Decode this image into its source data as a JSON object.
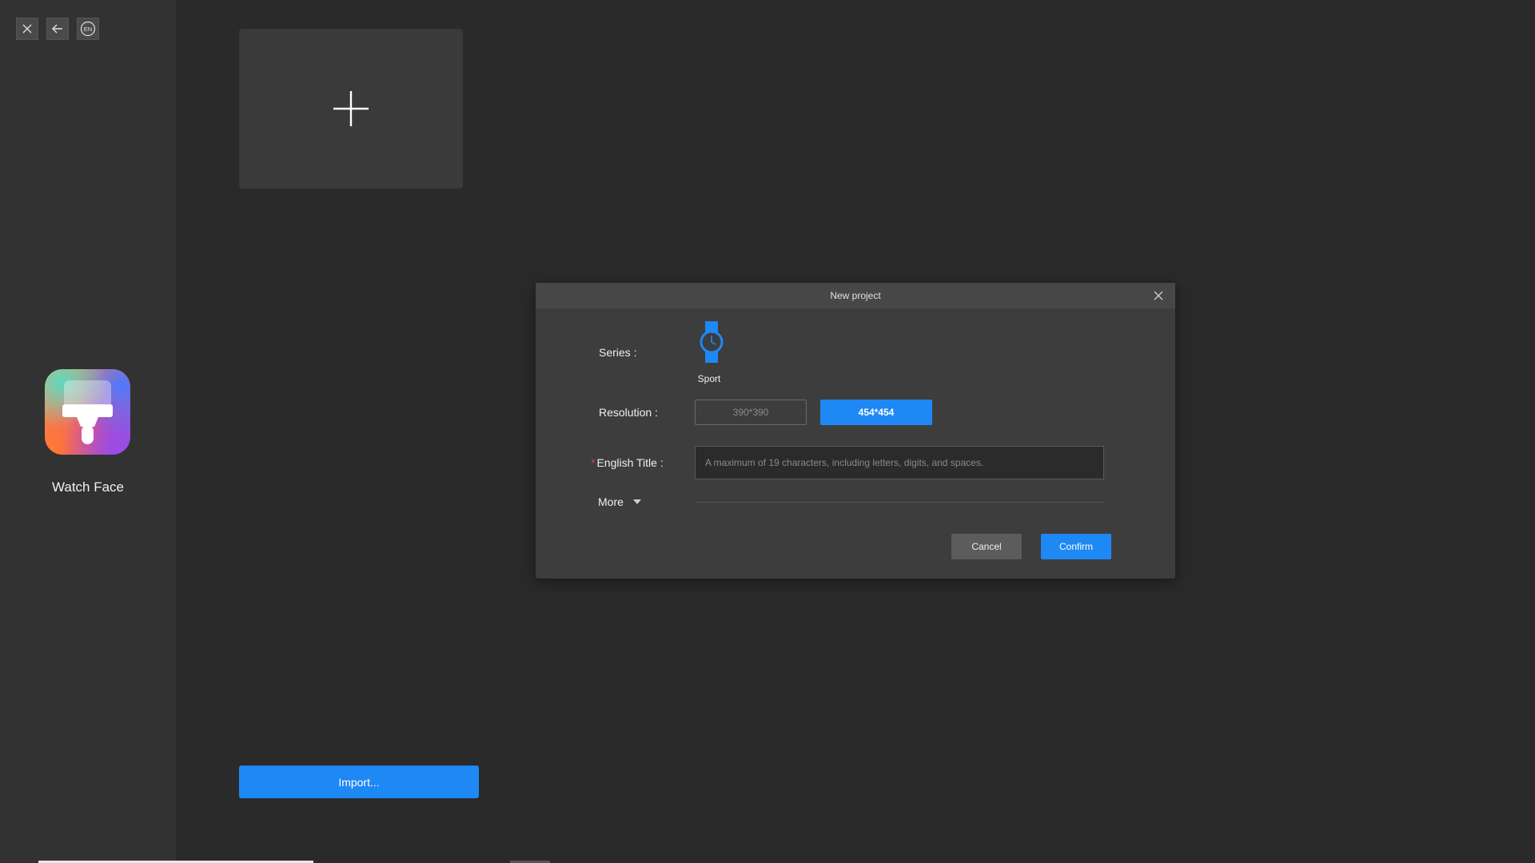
{
  "sidebar": {
    "app_name": "Watch Face",
    "buttons": [
      {
        "icon": "close-icon"
      },
      {
        "icon": "back-arrow-icon"
      },
      {
        "icon": "language-icon",
        "text": "EN"
      }
    ]
  },
  "main": {
    "new_card_icon": "plus-icon",
    "import_label": "Import..."
  },
  "dialog": {
    "title": "New project",
    "series": {
      "label": "Series :",
      "options": [
        {
          "name": "Sport",
          "icon": "watch-icon",
          "selected": true
        }
      ]
    },
    "resolution": {
      "label": "Resolution :",
      "options": [
        {
          "value": "390*390",
          "selected": false
        },
        {
          "value": "454*454",
          "selected": true
        }
      ]
    },
    "english_title": {
      "required_mark": "*",
      "label": "English Title :",
      "value": "",
      "placeholder": "A maximum of 19 characters, including letters, digits, and spaces."
    },
    "more_label": "More",
    "cancel_label": "Cancel",
    "confirm_label": "Confirm"
  },
  "colors": {
    "accent": "#1e88f5",
    "background": "#2a2a2a",
    "sidebar": "#323232",
    "dialog": "#3d3d3d"
  }
}
